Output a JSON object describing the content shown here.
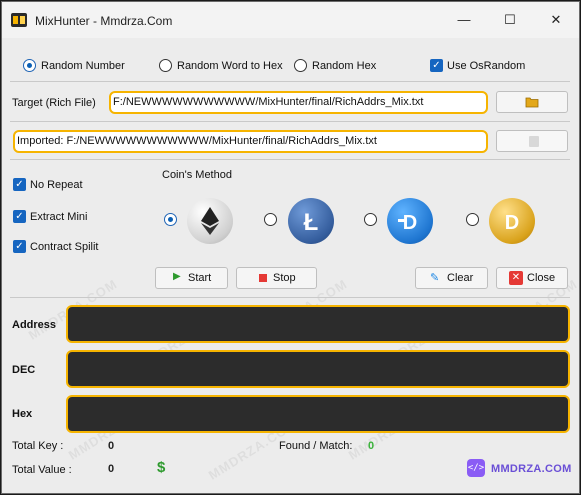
{
  "window": {
    "title": "MixHunter - Mmdrza.Com",
    "minimize": "—",
    "maximize": "☐",
    "close": "✕"
  },
  "modes": {
    "random_number": "Random Number",
    "random_word": "Random Word to Hex",
    "random_hex": "Random Hex",
    "use_osrandom": "Use OsRandom",
    "selected": "random_number"
  },
  "target": {
    "label": "Target (Rich File)",
    "path": "F:/NEWWWWWWWWWWW/MixHunter/final/RichAddrs_Mix.txt"
  },
  "imported": {
    "text": "Imported: F:/NEWWWWWWWWWWW/MixHunter/final/RichAddrs_Mix.txt"
  },
  "options": {
    "no_repeat": "No Repeat",
    "extract_mini": "Extract Mini",
    "contract_split": "Contract Spilit"
  },
  "coins": {
    "title": "Coin's Method",
    "items": [
      {
        "name": "ethereum",
        "color": "#dcdcdc"
      },
      {
        "name": "litecoin",
        "color": "#345d9d"
      },
      {
        "name": "dash",
        "color": "#1e75d0"
      },
      {
        "name": "dogecoin",
        "color": "#d9a21b"
      }
    ],
    "selected": "ethereum"
  },
  "buttons": {
    "start": "Start",
    "stop": "Stop",
    "clear": "Clear",
    "close": "Close"
  },
  "output": {
    "address": "Address",
    "dec": "DEC",
    "hex": "Hex"
  },
  "stats": {
    "total_key_label": "Total Key :",
    "total_key": "0",
    "found_label": "Found / Match:",
    "found": "0",
    "total_value_label": "Total Value :",
    "total_value": "0",
    "dollar": "$"
  },
  "brand": {
    "text": "MMDRZA.COM"
  },
  "watermark": "MMDRZA.COM",
  "colors": {
    "accent": "#f6b400",
    "brand": "#8a5cf5"
  }
}
